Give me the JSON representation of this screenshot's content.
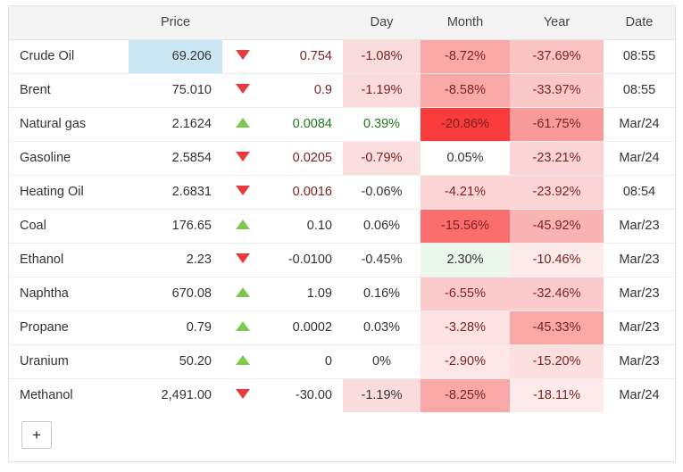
{
  "table": {
    "headers": {
      "name": "",
      "price": "Price",
      "arrow": "",
      "change": "",
      "day": "Day",
      "month": "Month",
      "year": "Year",
      "date": "Date"
    },
    "rows": [
      {
        "name": "Crude Oil",
        "price": "69.206",
        "price_highlight": true,
        "direction": "down",
        "change": "0.754",
        "change_sign": "neg",
        "day": "-1.08%",
        "day_sign": "neg",
        "day_bg": "#fbdcdc",
        "month": "-8.72%",
        "month_sign": "neg",
        "month_bg": "#f9a8a8",
        "year": "-37.69%",
        "year_sign": "neg",
        "year_bg": "#fac4c4",
        "date": "08:55"
      },
      {
        "name": "Brent",
        "price": "75.010",
        "price_highlight": false,
        "direction": "down",
        "change": "0.9",
        "change_sign": "neg",
        "day": "-1.19%",
        "day_sign": "neg",
        "day_bg": "#fbdcdc",
        "month": "-8.58%",
        "month_sign": "neg",
        "month_bg": "#f9a8a8",
        "year": "-33.97%",
        "year_sign": "neg",
        "year_bg": "#fac8c8",
        "date": "08:55"
      },
      {
        "name": "Natural gas",
        "price": "2.1624",
        "price_highlight": false,
        "direction": "up",
        "change": "0.0084",
        "change_sign": "pos",
        "day": "0.39%",
        "day_sign": "pos",
        "day_bg": "#ffffff",
        "month": "-20.86%",
        "month_sign": "neg",
        "month_bg": "#fa3b3b",
        "year": "-61.75%",
        "year_sign": "neg",
        "year_bg": "#f99a9a",
        "date": "Mar/24"
      },
      {
        "name": "Gasoline",
        "price": "2.5854",
        "price_highlight": false,
        "direction": "down",
        "change": "0.0205",
        "change_sign": "neg",
        "day": "-0.79%",
        "day_sign": "neg",
        "day_bg": "#fbdede",
        "month": "0.05%",
        "month_sign": "neu",
        "month_bg": "#ffffff",
        "year": "-23.21%",
        "year_sign": "neg",
        "year_bg": "#fbd5d5",
        "date": "Mar/24"
      },
      {
        "name": "Heating Oil",
        "price": "2.6831",
        "price_highlight": false,
        "direction": "down",
        "change": "0.0016",
        "change_sign": "neg",
        "day": "-0.06%",
        "day_sign": "neu",
        "day_bg": "#ffffff",
        "month": "-4.21%",
        "month_sign": "neg",
        "month_bg": "#fbd5d5",
        "year": "-23.92%",
        "year_sign": "neg",
        "year_bg": "#fbd5d5",
        "date": "08:54"
      },
      {
        "name": "Coal",
        "price": "176.65",
        "price_highlight": false,
        "direction": "up",
        "change": "0.10",
        "change_sign": "neu",
        "day": "0.06%",
        "day_sign": "neu",
        "day_bg": "#ffffff",
        "month": "-15.56%",
        "month_sign": "neg",
        "month_bg": "#fa6e6e",
        "year": "-45.92%",
        "year_sign": "neg",
        "year_bg": "#fab3b3",
        "date": "Mar/23"
      },
      {
        "name": "Ethanol",
        "price": "2.23",
        "price_highlight": false,
        "direction": "down",
        "change": "-0.0100",
        "change_sign": "neu",
        "day": "-0.45%",
        "day_sign": "neu",
        "day_bg": "#ffffff",
        "month": "2.30%",
        "month_sign": "neu",
        "month_bg": "#e9f7ec",
        "year": "-10.46%",
        "year_sign": "neg",
        "year_bg": "#fdeaea",
        "date": "Mar/23"
      },
      {
        "name": "Naphtha",
        "price": "670.08",
        "price_highlight": false,
        "direction": "up",
        "change": "1.09",
        "change_sign": "neu",
        "day": "0.16%",
        "day_sign": "neu",
        "day_bg": "#ffffff",
        "month": "-6.55%",
        "month_sign": "neg",
        "month_bg": "#fbcbcb",
        "year": "-32.46%",
        "year_sign": "neg",
        "year_bg": "#fbcbcb",
        "date": "Mar/23"
      },
      {
        "name": "Propane",
        "price": "0.79",
        "price_highlight": false,
        "direction": "up",
        "change": "0.0002",
        "change_sign": "neu",
        "day": "0.03%",
        "day_sign": "neu",
        "day_bg": "#ffffff",
        "month": "-3.28%",
        "month_sign": "neg",
        "month_bg": "#fce2e2",
        "year": "-45.33%",
        "year_sign": "neg",
        "year_bg": "#f9a8a8",
        "date": "Mar/23"
      },
      {
        "name": "Uranium",
        "price": "50.20",
        "price_highlight": false,
        "direction": "up",
        "change": "0",
        "change_sign": "neu",
        "day": "0%",
        "day_sign": "neu",
        "day_bg": "#ffffff",
        "month": "-2.90%",
        "month_sign": "neg",
        "month_bg": "#fce6e6",
        "year": "-15.20%",
        "year_sign": "neg",
        "year_bg": "#fce0e0",
        "date": "Mar/23"
      },
      {
        "name": "Methanol",
        "price": "2,491.00",
        "price_highlight": false,
        "direction": "down",
        "change": "-30.00",
        "change_sign": "neu",
        "day": "-1.19%",
        "day_sign": "neu",
        "day_bg": "#fbdcdc",
        "month": "-8.25%",
        "month_sign": "neg",
        "month_bg": "#f9a8a8",
        "year": "-18.11%",
        "year_sign": "neg",
        "year_bg": "#fdeaea",
        "date": "Mar/24"
      }
    ]
  },
  "footer": {
    "add_label": "+"
  },
  "colors": {
    "header_bg": "#f4f4f4",
    "price_highlight": "#cbe7f5",
    "arrow_up": "#7ec850",
    "arrow_down": "#e83c3c",
    "negative_text": "#7d2222",
    "positive_text": "#1d7a1d"
  }
}
